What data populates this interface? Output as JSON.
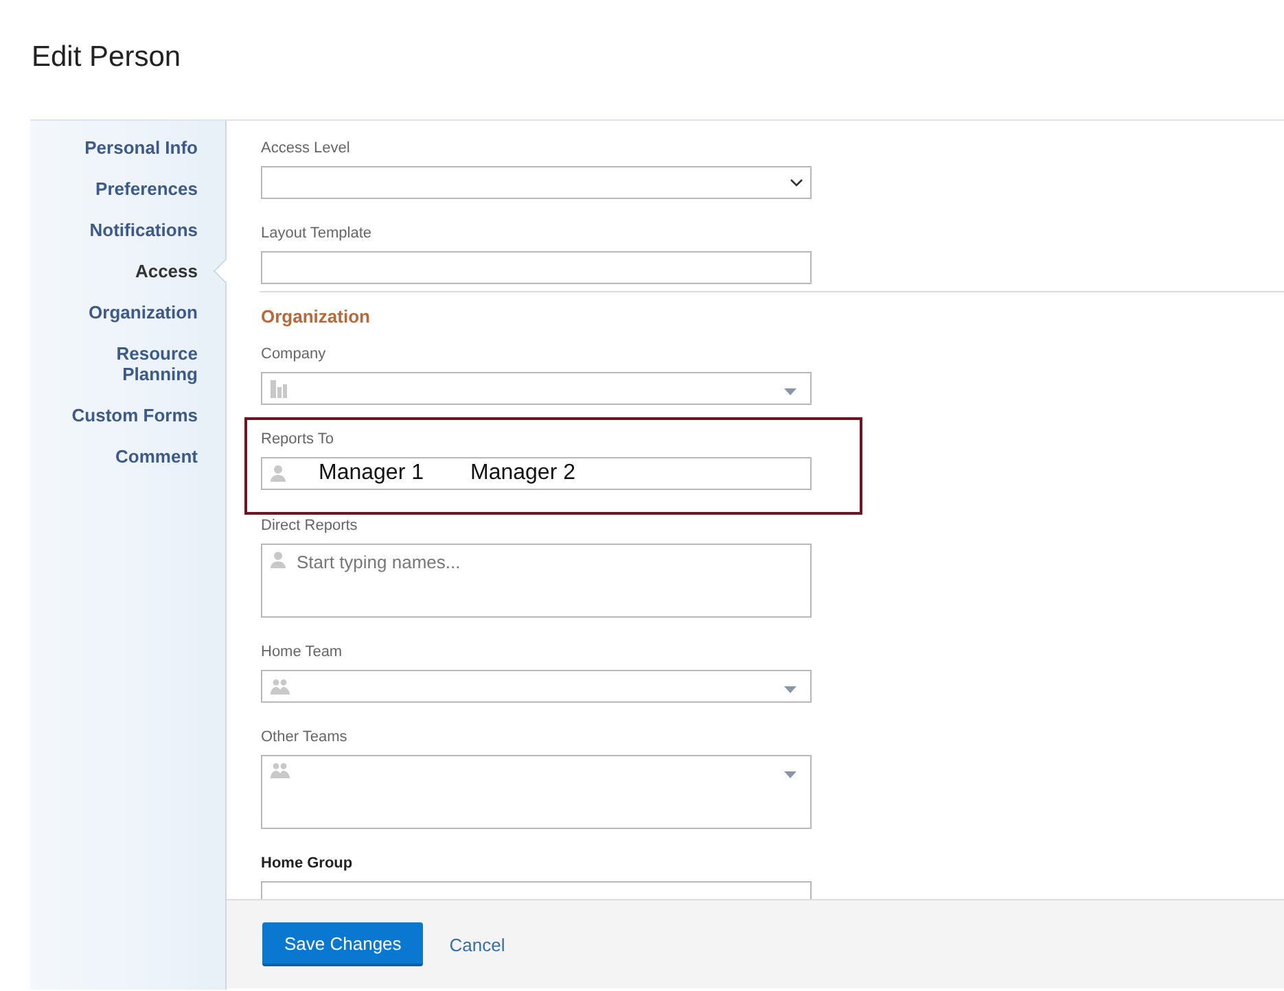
{
  "page": {
    "title": "Edit Person"
  },
  "nav": [
    {
      "label": "Personal Info",
      "selected": false
    },
    {
      "label": "Preferences",
      "selected": false
    },
    {
      "label": "Notifications",
      "selected": false
    },
    {
      "label": "Access",
      "selected": true
    },
    {
      "label": "Organization",
      "selected": false
    },
    {
      "label": "Resource Planning",
      "selected": false
    },
    {
      "label": "Custom Forms",
      "selected": false
    },
    {
      "label": "Comment",
      "selected": false
    }
  ],
  "fields": [
    {
      "kind": "select",
      "label": "Access Level"
    },
    {
      "kind": "text",
      "label": "Layout Template"
    },
    {
      "kind": "heading",
      "label": "Organization"
    },
    {
      "kind": "company",
      "label": "Company"
    },
    {
      "kind": "people",
      "label": "Reports To",
      "values": [
        "Manager 1",
        "Manager 2"
      ],
      "highlighted": true
    },
    {
      "kind": "people-area",
      "label": "Direct Reports",
      "placeholder": "Start typing names...",
      "highlighted": false
    },
    {
      "kind": "team",
      "label": "Home Team"
    },
    {
      "kind": "team-area",
      "label": "Other Teams"
    },
    {
      "kind": "group",
      "label": "Home Group"
    }
  ],
  "footer": {
    "save": "Save Changes",
    "cancel": "Cancel"
  }
}
